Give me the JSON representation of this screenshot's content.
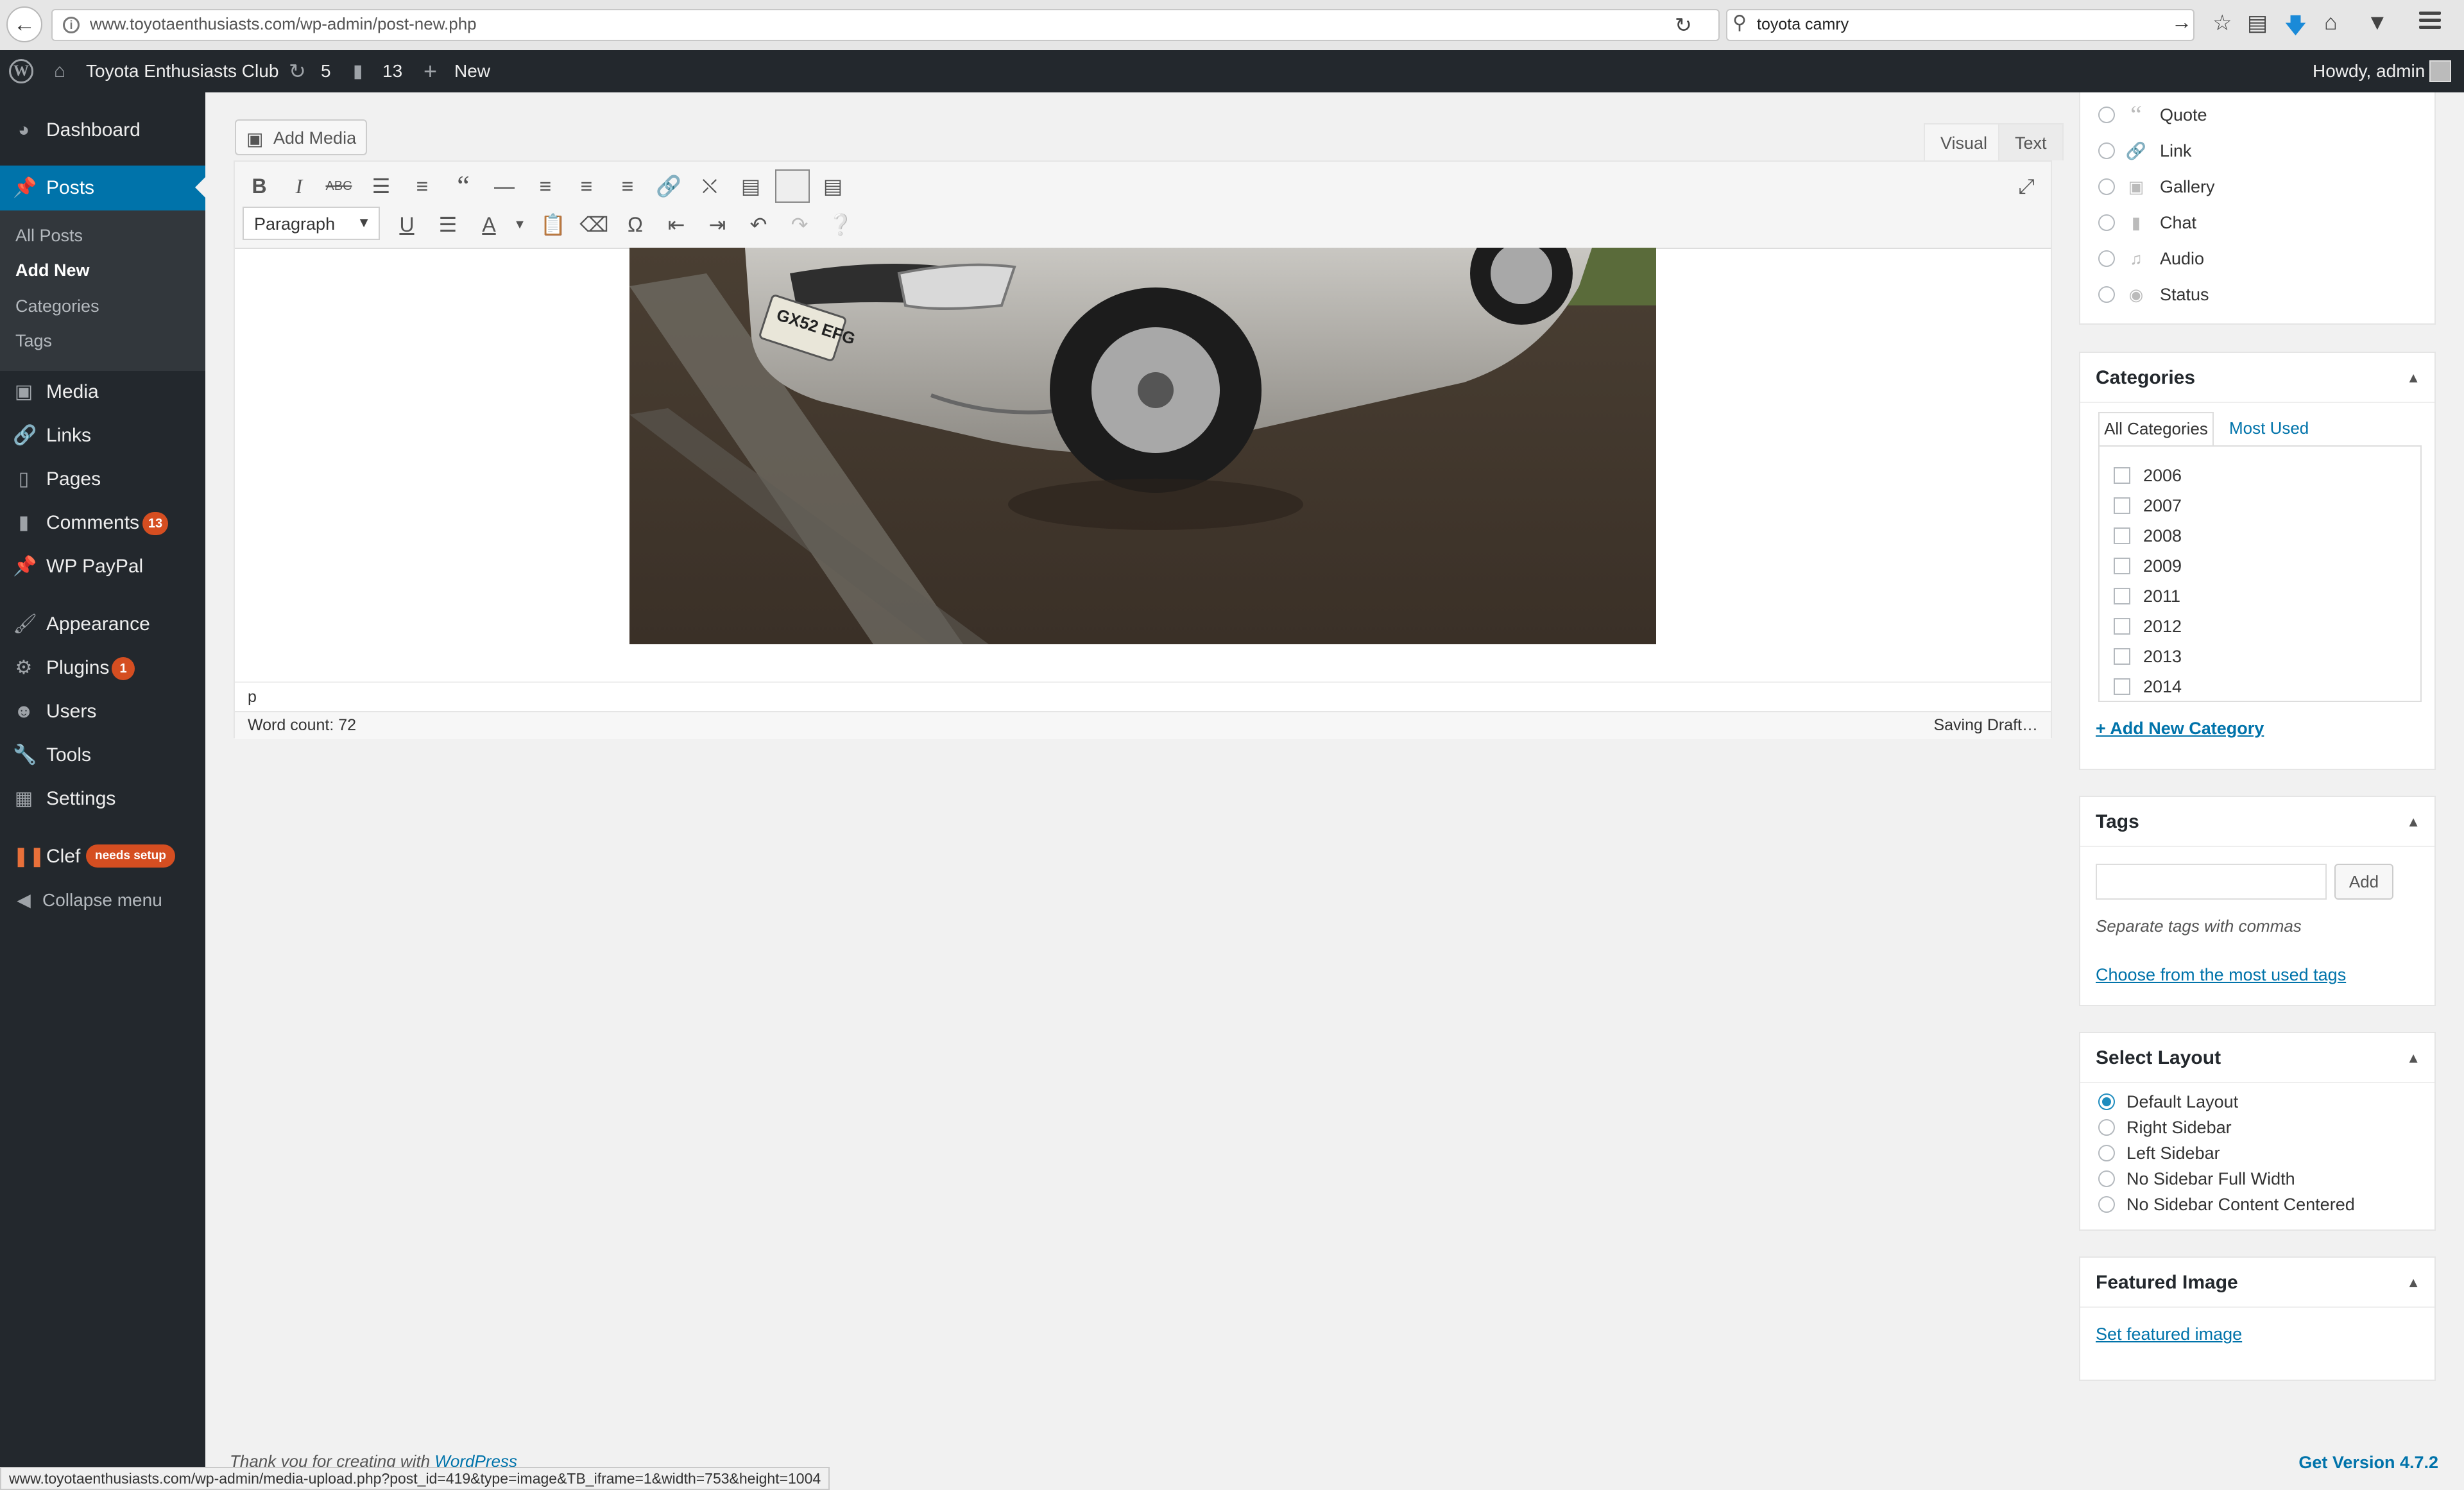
{
  "browser": {
    "url": "www.toyotaenthusiasts.com/wp-admin/post-new.php",
    "search_query": "toyota camry",
    "status_url": "www.toyotaenthusiasts.com/wp-admin/media-upload.php?post_id=419&type=image&TB_iframe=1&width=753&height=1004"
  },
  "admin_bar": {
    "site_name": "Toyota Enthusiasts Club",
    "updates_count": "5",
    "comments_count": "13",
    "new_label": "New",
    "greeting": "Howdy, admin"
  },
  "sidebar": {
    "dashboard": "Dashboard",
    "posts": "Posts",
    "submenu": [
      "All Posts",
      "Add New",
      "Categories",
      "Tags"
    ],
    "media": "Media",
    "links": "Links",
    "pages": "Pages",
    "comments": "Comments",
    "comments_badge": "13",
    "wp_paypal": "WP PayPal",
    "appearance": "Appearance",
    "plugins": "Plugins",
    "plugins_badge": "1",
    "users": "Users",
    "tools": "Tools",
    "settings": "Settings",
    "clef": "Clef",
    "clef_badge": "needs setup",
    "collapse": "Collapse menu"
  },
  "editor": {
    "add_media": "Add Media",
    "tab_visual": "Visual",
    "tab_text": "Text",
    "format_value": "Paragraph",
    "path": "p",
    "word_count": "Word count: 72",
    "save_status": "Saving Draft…",
    "plate_text": "GX52 EFG"
  },
  "format_box": {
    "options": [
      "Quote",
      "Link",
      "Gallery",
      "Chat",
      "Audio",
      "Status"
    ]
  },
  "categories_box": {
    "title": "Categories",
    "tab_all": "All Categories",
    "tab_most_used": "Most Used",
    "items": [
      "2006",
      "2007",
      "2008",
      "2009",
      "2011",
      "2012",
      "2013",
      "2014"
    ],
    "add_new": "+ Add New Category"
  },
  "tags_box": {
    "title": "Tags",
    "add_button": "Add",
    "hint": "Separate tags with commas",
    "choose_link": "Choose from the most used tags"
  },
  "layout_box": {
    "title": "Select Layout",
    "options": [
      "Default Layout",
      "Right Sidebar",
      "Left Sidebar",
      "No Sidebar Full Width",
      "No Sidebar Content Centered"
    ],
    "selected": "Default Layout"
  },
  "featured_box": {
    "title": "Featured Image",
    "link": "Set featured image"
  },
  "footer": {
    "thanks_prefix": "Thank you for creating with ",
    "thanks_link": "WordPress",
    "version": "Get Version 4.7.2"
  },
  "colors": {
    "admin_dark": "#23282d",
    "accent_blue": "#0073aa",
    "badge_orange": "#d54e21"
  }
}
